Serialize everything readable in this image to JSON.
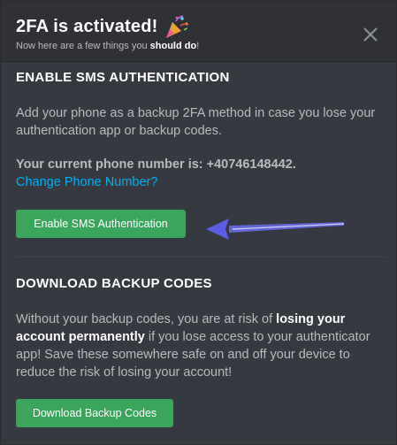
{
  "header": {
    "title": "2FA is activated!",
    "subtitle_prefix": "Now here are a few things you ",
    "subtitle_strong": "should do",
    "subtitle_suffix": "!"
  },
  "sms_section": {
    "heading": "ENABLE SMS AUTHENTICATION",
    "description": "Add your phone as a backup 2FA method in case you lose your authentication app or backup codes.",
    "phone_text": "Your current phone number is: +40746148442.",
    "change_link": "Change Phone Number?",
    "enable_button": "Enable SMS Authentication"
  },
  "backup_section": {
    "heading": "DOWNLOAD BACKUP CODES",
    "desc_prefix": "Without your backup codes, you are at risk of ",
    "desc_strong": "losing your account permanently",
    "desc_suffix": " if you lose access to your authenticator app! Save these somewhere safe on and off your device to reduce the risk of losing your account!",
    "download_button": "Download Backup Codes"
  },
  "colors": {
    "background": "#36393f",
    "header_bg": "#2f3136",
    "button_green": "#3ba55c",
    "link_blue": "#00b0f4",
    "arrow": "#6b6ef2"
  },
  "icons": {
    "title_icon": "party-popper-icon",
    "close_icon": "close-icon",
    "annotation": "arrow-left-icon"
  }
}
